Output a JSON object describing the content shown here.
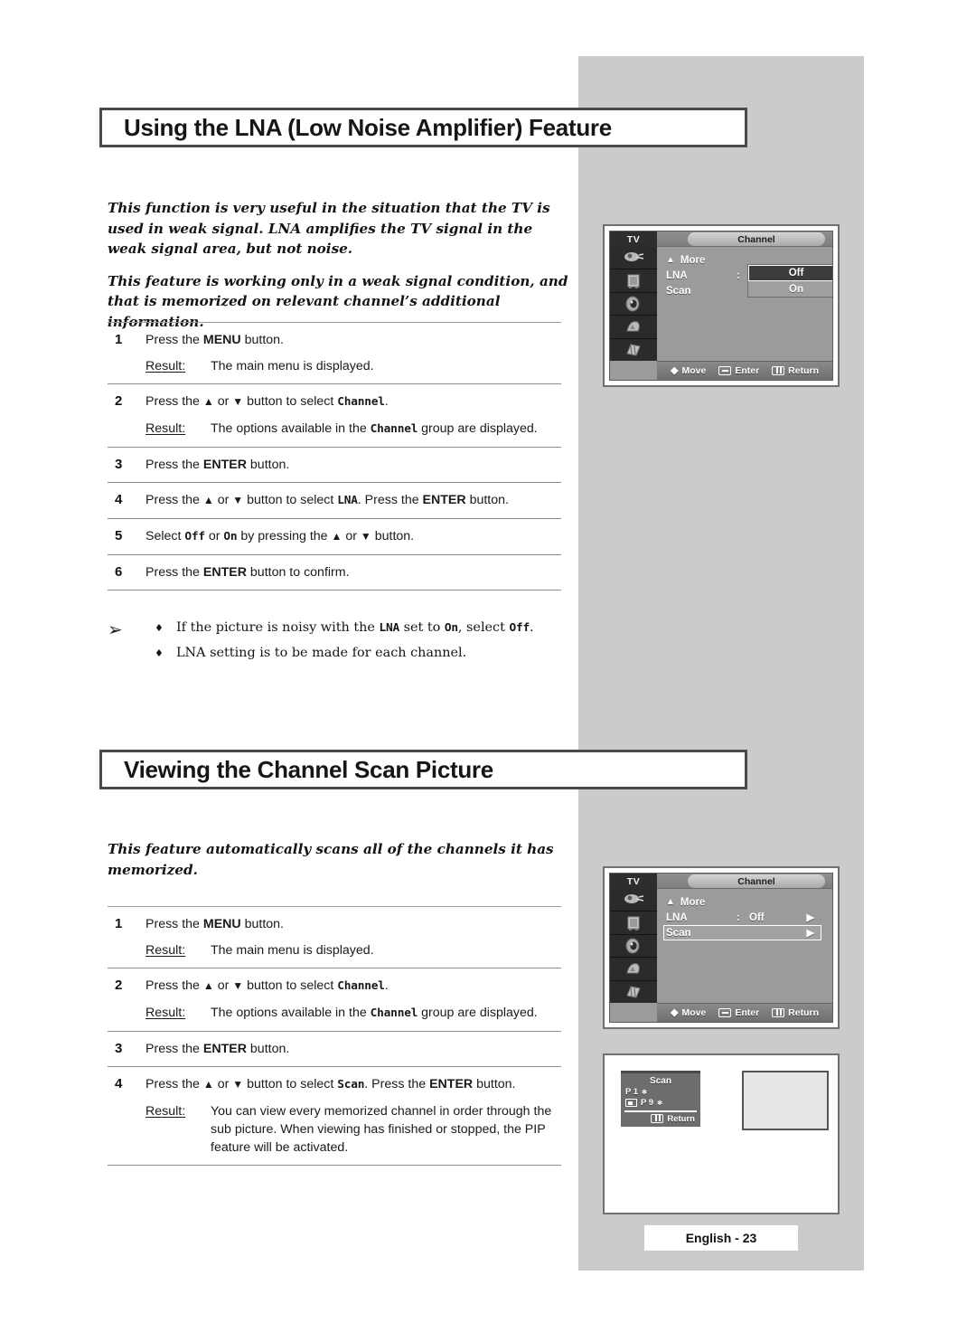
{
  "page": {
    "footer_label": "English - 23"
  },
  "section1": {
    "title": "Using the LNA (Low Noise Amplifier) Feature",
    "intro": [
      "This function is very useful in the situation that the TV is used in weak signal. LNA amplifies the TV signal in the weak signal area, but not noise.",
      "This feature is working only in a weak signal condition, and that is memorized on relevant channel’s additional information."
    ],
    "steps": [
      {
        "num": "1",
        "text_parts": [
          {
            "t": "Press the ",
            "style": "plain"
          },
          {
            "t": "MENU",
            "style": "bold"
          },
          {
            "t": " button.",
            "style": "plain"
          }
        ],
        "result_label": "Result:",
        "result_parts": [
          {
            "t": "The main menu is displayed.",
            "style": "plain"
          }
        ]
      },
      {
        "num": "2",
        "text_parts": [
          {
            "t": "Press the ",
            "style": "plain"
          },
          {
            "t": "▲",
            "style": "glyph"
          },
          {
            "t": " or ",
            "style": "plain"
          },
          {
            "t": "▼",
            "style": "glyph"
          },
          {
            "t": " button to select ",
            "style": "plain"
          },
          {
            "t": "Channel",
            "style": "mono"
          },
          {
            "t": ".",
            "style": "plain"
          }
        ],
        "result_label": "Result:",
        "result_parts": [
          {
            "t": "The options available in the ",
            "style": "plain"
          },
          {
            "t": "Channel",
            "style": "mono"
          },
          {
            "t": " group are displayed.",
            "style": "plain"
          }
        ]
      },
      {
        "num": "3",
        "text_parts": [
          {
            "t": "Press the ",
            "style": "plain"
          },
          {
            "t": "ENTER",
            "style": "bold"
          },
          {
            "t": " button.",
            "style": "plain"
          }
        ],
        "result_label": "",
        "result_parts": []
      },
      {
        "num": "4",
        "text_parts": [
          {
            "t": "Press the ",
            "style": "plain"
          },
          {
            "t": "▲",
            "style": "glyph"
          },
          {
            "t": " or ",
            "style": "plain"
          },
          {
            "t": "▼",
            "style": "glyph"
          },
          {
            "t": " button to select ",
            "style": "plain"
          },
          {
            "t": "LNA",
            "style": "mono"
          },
          {
            "t": ". Press the ",
            "style": "plain"
          },
          {
            "t": "ENTER",
            "style": "bold"
          },
          {
            "t": " button.",
            "style": "plain"
          }
        ],
        "result_label": "",
        "result_parts": []
      },
      {
        "num": "5",
        "text_parts": [
          {
            "t": "Select ",
            "style": "plain"
          },
          {
            "t": "Off",
            "style": "mono"
          },
          {
            "t": " or ",
            "style": "plain"
          },
          {
            "t": "On",
            "style": "mono"
          },
          {
            "t": "  by pressing the ",
            "style": "plain"
          },
          {
            "t": "▲",
            "style": "glyph"
          },
          {
            "t": " or ",
            "style": "plain"
          },
          {
            "t": "▼",
            "style": "glyph"
          },
          {
            "t": " button.",
            "style": "plain"
          }
        ],
        "result_label": "",
        "result_parts": []
      },
      {
        "num": "6",
        "text_parts": [
          {
            "t": "Press the ",
            "style": "plain"
          },
          {
            "t": "ENTER",
            "style": "bold"
          },
          {
            "t": " button to confirm.",
            "style": "plain"
          }
        ],
        "result_label": "",
        "result_parts": []
      }
    ],
    "notes_marker": "➢",
    "notes": [
      {
        "bullet": "♦",
        "parts": [
          {
            "t": "If the picture is noisy with the ",
            "style": "plain"
          },
          {
            "t": "LNA",
            "style": "mono"
          },
          {
            "t": " set to ",
            "style": "plain"
          },
          {
            "t": "On",
            "style": "mono"
          },
          {
            "t": ", select ",
            "style": "plain"
          },
          {
            "t": "Off",
            "style": "mono"
          },
          {
            "t": ".",
            "style": "plain"
          }
        ]
      },
      {
        "bullet": "♦",
        "parts": [
          {
            "t": "LNA setting is to be made for each channel.",
            "style": "plain"
          }
        ]
      }
    ]
  },
  "section2": {
    "title": "Viewing the Channel Scan Picture",
    "intro": [
      "This feature automatically scans all of the channels it has memorized."
    ],
    "steps": [
      {
        "num": "1",
        "text_parts": [
          {
            "t": "Press the ",
            "style": "plain"
          },
          {
            "t": "MENU",
            "style": "bold"
          },
          {
            "t": " button.",
            "style": "plain"
          }
        ],
        "result_label": "Result:",
        "result_parts": [
          {
            "t": "The main menu is displayed.",
            "style": "plain"
          }
        ]
      },
      {
        "num": "2",
        "text_parts": [
          {
            "t": "Press the ",
            "style": "plain"
          },
          {
            "t": "▲",
            "style": "glyph"
          },
          {
            "t": " or ",
            "style": "plain"
          },
          {
            "t": "▼",
            "style": "glyph"
          },
          {
            "t": " button to select ",
            "style": "plain"
          },
          {
            "t": "Channel",
            "style": "mono"
          },
          {
            "t": ".",
            "style": "plain"
          }
        ],
        "result_label": "Result:",
        "result_parts": [
          {
            "t": "The options available in the ",
            "style": "plain"
          },
          {
            "t": "Channel",
            "style": "mono"
          },
          {
            "t": " group are displayed.",
            "style": "plain"
          }
        ]
      },
      {
        "num": "3",
        "text_parts": [
          {
            "t": "Press the ",
            "style": "plain"
          },
          {
            "t": "ENTER",
            "style": "bold"
          },
          {
            "t": " button.",
            "style": "plain"
          }
        ],
        "result_label": "",
        "result_parts": []
      },
      {
        "num": "4",
        "text_parts": [
          {
            "t": "Press the ",
            "style": "plain"
          },
          {
            "t": "▲",
            "style": "glyph"
          },
          {
            "t": " or ",
            "style": "plain"
          },
          {
            "t": "▼",
            "style": "glyph"
          },
          {
            "t": " button to select ",
            "style": "plain"
          },
          {
            "t": "Scan",
            "style": "mono"
          },
          {
            "t": ". Press the ",
            "style": "plain"
          },
          {
            "t": "ENTER",
            "style": "bold"
          },
          {
            "t": " button.",
            "style": "plain"
          }
        ],
        "result_label": "Result:",
        "result_parts": [
          {
            "t": "You can view every memorized channel in order through the sub picture. When viewing has finished or stopped, the PIP feature will be activated.",
            "style": "plain"
          }
        ]
      }
    ]
  },
  "osd1": {
    "tv_tab": "TV",
    "menu_title": "Channel",
    "more_caret": "▲",
    "more_label": "More",
    "rows": [
      {
        "label": "LNA",
        "colon": ":",
        "value": ""
      },
      {
        "label": "Scan",
        "colon": "",
        "value": ""
      }
    ],
    "options": [
      {
        "label": "Off",
        "selected": true
      },
      {
        "label": "On",
        "selected": false
      }
    ],
    "footer": [
      {
        "glyph": "♦",
        "label": "Move"
      },
      {
        "glyph": "",
        "label": "Enter"
      },
      {
        "glyph": "",
        "label": "Return"
      }
    ]
  },
  "osd2": {
    "tv_tab": "TV",
    "menu_title": "Channel",
    "more_caret": "▲",
    "more_label": "More",
    "rows": [
      {
        "label": "LNA",
        "colon": ":",
        "value": "Off",
        "caret": "▶",
        "highlighted": false
      },
      {
        "label": "Scan",
        "colon": "",
        "value": "",
        "caret": "▶",
        "highlighted": true
      }
    ],
    "footer": [
      {
        "glyph": "♦",
        "label": "Move"
      },
      {
        "glyph": "",
        "label": "Enter"
      },
      {
        "glyph": "",
        "label": "Return"
      }
    ]
  },
  "scan_osd": {
    "title": "Scan",
    "line1_label": "P  1",
    "line1_star": "✻",
    "line2_label": "P  9",
    "line2_star": "✻",
    "return_label": "Return"
  },
  "colors": {
    "panel_grey": "#cbcbcb",
    "osd_grey": "#9b9b9b",
    "osd_dark": "#2e2e2e",
    "text": "#161616"
  }
}
